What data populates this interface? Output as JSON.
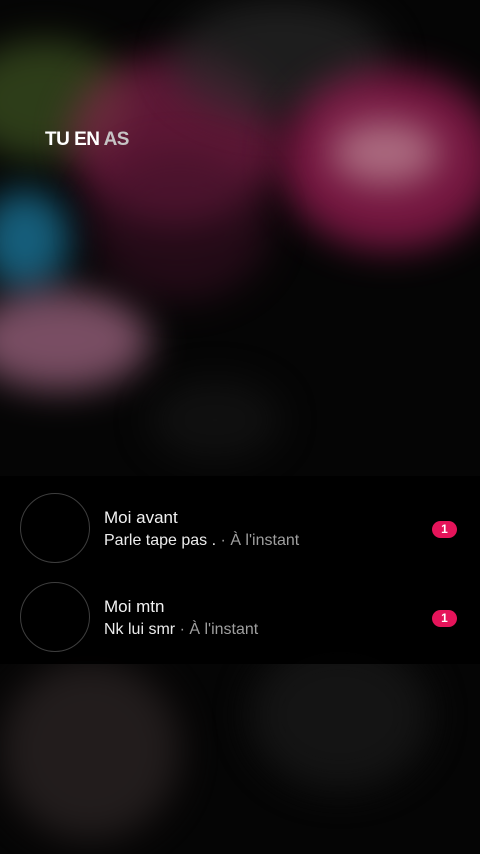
{
  "header": {
    "title_part1": "TU EN",
    "title_part2": "AS"
  },
  "chats": [
    {
      "name": "Moi avant",
      "message": "Parle tape pas .",
      "separator": "·",
      "time": "À l'instant",
      "unread": "1"
    },
    {
      "name": "Moi mtn",
      "message": "Nk lui smr",
      "separator": "·",
      "time": "À l'instant",
      "unread": "1"
    }
  ],
  "colors": {
    "badge": "#e5145a",
    "background": "#050505",
    "title": "#ffffff",
    "title_accent": "#c6c3c4"
  }
}
